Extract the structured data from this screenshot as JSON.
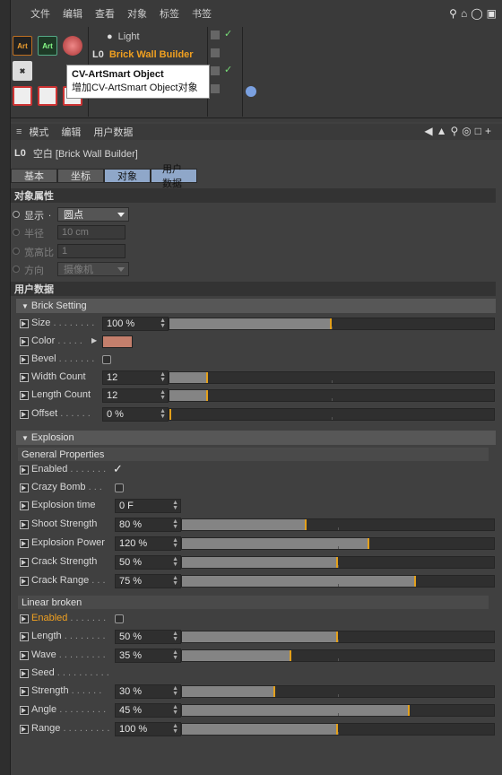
{
  "menu": {
    "items": [
      "文件",
      "编辑",
      "查看",
      "对象",
      "标签",
      "书签"
    ]
  },
  "objects": {
    "light": "Light",
    "brick": "Brick Wall Builder"
  },
  "tooltip": {
    "title": "CV-ArtSmart Object",
    "desc": "增加CV-ArtSmart Object对象"
  },
  "palette": {
    "art1": "Art",
    "art2": "Art"
  },
  "attr": {
    "menu": [
      "模式",
      "编辑",
      "用户数据"
    ],
    "title": "空白 [Brick Wall Builder]",
    "tabs": [
      "基本",
      "坐标",
      "对象",
      "用户数据"
    ],
    "obj_section": "对象属性",
    "display_label": "显示",
    "display_value": "圆点",
    "radius_label": "半径",
    "radius_value": "10 cm",
    "aspect_label": "宽高比",
    "aspect_value": "1",
    "orient_label": "方向",
    "orient_value": "摄像机",
    "user_section": "用户数据",
    "brick_group": "Brick  Setting",
    "size_label": "Size",
    "size_value": "100 %",
    "size_level": 0.5,
    "color_label": "Color",
    "color_value": "#c47f6c",
    "bevel_label": "Bevel",
    "width_label": "Width Count",
    "width_value": "12",
    "width_level": 0.12,
    "length_label": "Length Count",
    "length_value": "12",
    "length_level": 0.12,
    "offset_label": "Offset",
    "offset_value": "0 %",
    "offset_level": 0.0,
    "explosion_group": "Explosion",
    "general_sub": "General Properties",
    "enabled_label": "Enabled",
    "crazy_label": "Crazy Bomb",
    "time_label": "Explosion time",
    "time_value": "0 F",
    "shoot_label": "Shoot Strength",
    "shoot_value": "80 %",
    "shoot_level": 0.4,
    "power_label": "Explosion Power",
    "power_value": "120 %",
    "power_level": 0.6,
    "crack_label": "Crack Strength",
    "crack_value": "50 %",
    "crack_level": 0.5,
    "range_label": "Crack Range",
    "range_value": "75 %",
    "range_level": 0.75,
    "linear_sub": "Linear broken",
    "lenabled_label": "Enabled",
    "llength_label": "Length",
    "llength_value": "50 %",
    "llength_level": 0.5,
    "wave_label": "Wave",
    "wave_value": "35 %",
    "wave_level": 0.35,
    "seed_label": "Seed",
    "strength_label": "Strength",
    "strength_value": "30 %",
    "strength_level": 0.3,
    "angle_label": "Angle",
    "angle_value": "45 %",
    "angle_level": 0.73,
    "lrange_label": "Range",
    "lrange_value": "100 %",
    "lrange_level": 0.5
  },
  "colors": {
    "accent": "#e3a01b",
    "selected_tab": "#8fa7c9",
    "brick_name": "#f0a020"
  }
}
